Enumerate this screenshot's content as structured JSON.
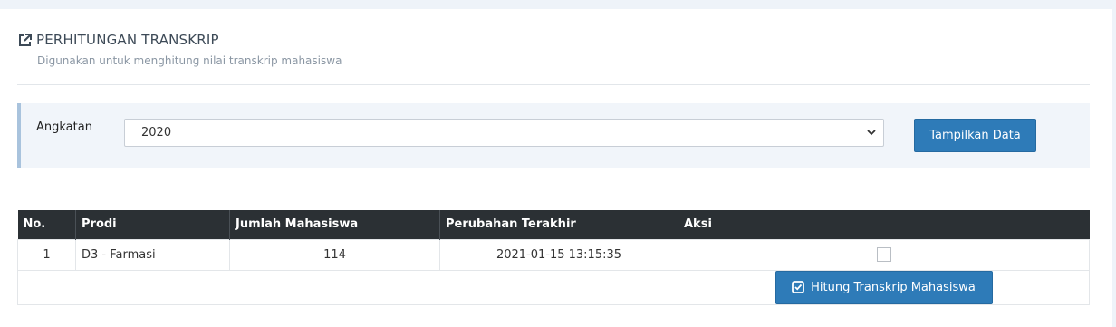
{
  "header": {
    "title": "PERHITUNGAN TRANSKRIP",
    "subtitle": "Digunakan untuk menghitung nilai transkrip mahasiswa"
  },
  "filter": {
    "label": "Angkatan",
    "selected_value": "2020",
    "button_label": "Tampilkan Data"
  },
  "table": {
    "columns": [
      "No.",
      "Prodi",
      "Jumlah Mahasiswa",
      "Perubahan Terakhir",
      "Aksi"
    ],
    "rows": [
      {
        "no": "1",
        "prodi": "D3 - Farmasi",
        "jumlah": "114",
        "perubahan": "2021-01-15 13:15:35"
      }
    ],
    "action_button_label": "Hitung Transkrip Mahasiswa"
  },
  "colors": {
    "primary": "#2e7bb8",
    "table_header": "#2b3034",
    "filter_bg": "#f1f5fa",
    "filter_accent": "#a9c3dd"
  },
  "icons": {
    "header": "external-link-icon",
    "select": "chevron-down-icon",
    "action": "check-square-icon"
  }
}
